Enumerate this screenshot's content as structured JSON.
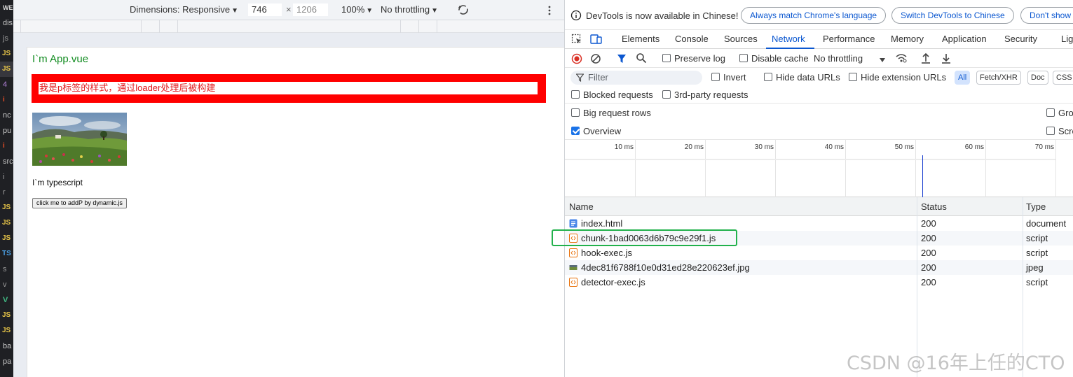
{
  "editor_strip": {
    "items": [
      "WEBP",
      "dis",
      "js",
      "JS",
      "JS",
      "4",
      "i",
      "nc",
      "pu",
      "i",
      "src",
      "i",
      "r",
      "JS",
      "JS",
      "JS",
      "TS",
      "s",
      "v",
      "V",
      "JS",
      "JS",
      "ba",
      "pa"
    ]
  },
  "device_toolbar": {
    "dimensions_label": "Dimensions: Responsive",
    "width_value": "746",
    "times": "×",
    "height_value": "1206",
    "zoom": "100%",
    "throttling": "No throttling"
  },
  "page": {
    "title": "I`m App.vue",
    "p_text": "我是p标签的样式，通过loader处理后被构建",
    "ts_text": "I`m typescript",
    "button_label": "click me to addP by dynamic.js"
  },
  "devtools": {
    "banner": {
      "text": "DevTools is now available in Chinese!",
      "btn_match": "Always match Chrome's language",
      "btn_switch": "Switch DevTools to Chinese",
      "btn_dont": "Don't show a"
    },
    "tabs": [
      "Elements",
      "Console",
      "Sources",
      "Network",
      "Performance",
      "Memory",
      "Application",
      "Security",
      "Lig"
    ],
    "toolbar": {
      "preserve_log": "Preserve log",
      "disable_cache": "Disable cache",
      "throttling": "No throttling"
    },
    "filter": {
      "placeholder": "Filter",
      "invert": "Invert",
      "hide_data_urls": "Hide data URLs",
      "hide_ext_urls": "Hide extension URLs",
      "types": [
        "All",
        "Fetch/XHR",
        "Doc",
        "CSS"
      ]
    },
    "options": {
      "blocked": "Blocked requests",
      "third_party": "3rd-party requests",
      "big_rows": "Big request rows",
      "overview": "Overview",
      "group": "Gro",
      "screenshots": "Scre"
    },
    "overview_ticks": [
      "10 ms",
      "20 ms",
      "30 ms",
      "40 ms",
      "50 ms",
      "60 ms",
      "70 ms"
    ],
    "table": {
      "headers": [
        "Name",
        "Status",
        "Type"
      ],
      "rows": [
        {
          "name": "index.html",
          "status": "200",
          "type": "document"
        },
        {
          "name": "chunk-1bad0063d6b79c9e29f1.js",
          "status": "200",
          "type": "script"
        },
        {
          "name": "hook-exec.js",
          "status": "200",
          "type": "script"
        },
        {
          "name": "4dec81f6788f10e0d31ed28e220623ef.jpg",
          "status": "200",
          "type": "jpeg"
        },
        {
          "name": "detector-exec.js",
          "status": "200",
          "type": "script"
        }
      ]
    }
  },
  "watermark": "CSDN @16年上任的CTO"
}
